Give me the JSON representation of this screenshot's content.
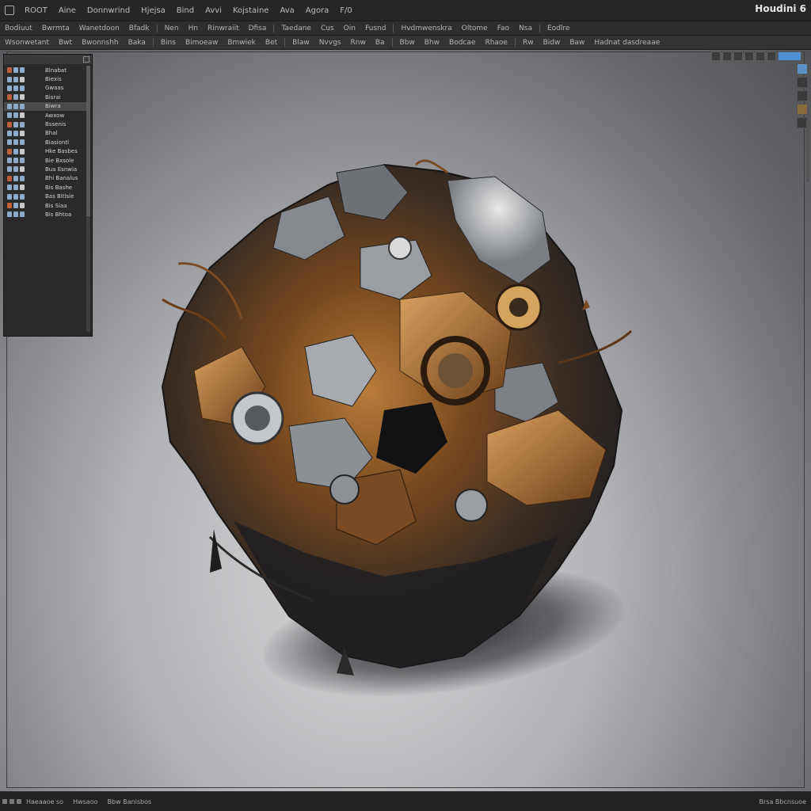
{
  "app": {
    "title": "Houdini 6"
  },
  "menu": {
    "items": [
      "ROOT",
      "Aine",
      "Donnwrind",
      "Hjejsa",
      "Bind",
      "Avvi",
      "Kojstaine",
      "Ava",
      "Agora",
      "F/0"
    ]
  },
  "toolbar_row1": {
    "items": [
      "Bodiuut",
      "Bwrmta",
      "Wanetdoon",
      "Bfadk",
      "Nen",
      "Hn",
      "Rinwraiit",
      "Dfisa",
      "Taedane",
      "Cus",
      "Oin",
      "Fusnd",
      "Hvdmwenskra",
      "Oltome",
      "Fao",
      "Nsa",
      "Eodlre"
    ]
  },
  "toolbar_row2": {
    "items": [
      "Wsonwetant",
      "Bwt",
      "Bwonnshh",
      "Baka",
      "Bins",
      "Bimoeaw",
      "Bmwiek",
      "Bet",
      "Blaw",
      "Nvvgs",
      "Rnw",
      "Ba",
      "Bbw",
      "Bhw",
      "Bodcae",
      "Rhaoe",
      "Rw",
      "Bidw",
      "Baw",
      "Hadnat dasdreaae"
    ]
  },
  "outliner": {
    "items": [
      {
        "label": "Blnabat"
      },
      {
        "label": "Biexis"
      },
      {
        "label": "Gwaas"
      },
      {
        "label": "Bisrai"
      },
      {
        "label": "Biwra"
      },
      {
        "label": "Awxow"
      },
      {
        "label": "Bssenis"
      },
      {
        "label": "Bhal"
      },
      {
        "label": "Biasiontl"
      },
      {
        "label": "Hke Basbes"
      },
      {
        "label": "Bie Bxsole"
      },
      {
        "label": "Bua Esnwia"
      },
      {
        "label": "Bhi Banalus"
      },
      {
        "label": "Bis Bashe"
      },
      {
        "label": "Bas Bitlsie"
      },
      {
        "label": "Bis Siaa"
      },
      {
        "label": "Bis Bhtoa"
      }
    ]
  },
  "statusbar": {
    "items": [
      "Haeaaoe so",
      "Hwsaoo",
      "Bbw Banisbos"
    ],
    "right": "Brsa Bbcnsuoe"
  },
  "colors": {
    "accent": "#4f8fd6",
    "viewport_center": "#d7d7d9",
    "viewport_edge": "#505155",
    "rust": "#9b5a22",
    "steel": "#9ea3a8"
  }
}
